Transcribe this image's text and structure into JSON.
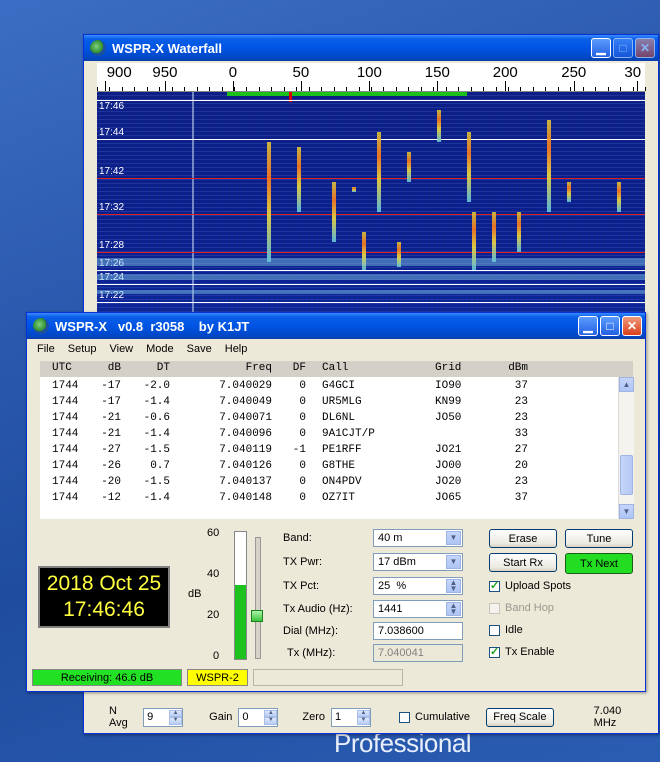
{
  "desktop": {
    "text": "Professional"
  },
  "waterfall": {
    "title": "WSPR-X Waterfall",
    "freq_ticks": [
      {
        "label": "900",
        "pos": 0.015
      },
      {
        "label": "950",
        "pos": 0.124
      },
      {
        "label": "0",
        "pos": 0.248
      },
      {
        "label": "50",
        "pos": 0.372
      },
      {
        "label": "100",
        "pos": 0.497
      },
      {
        "label": "150",
        "pos": 0.621
      },
      {
        "label": "200",
        "pos": 0.745
      },
      {
        "label": "250",
        "pos": 0.87
      },
      {
        "label": "30",
        "pos": 0.985
      }
    ],
    "time_labels": [
      "17:46",
      "17:44",
      "17:42",
      "17:32",
      "17:28",
      "17:26",
      "17:24",
      "17:22"
    ],
    "controls": {
      "navg_label": "N Avg",
      "navg_value": "9",
      "gain_label": "Gain",
      "gain_value": "0",
      "zero_label": "Zero",
      "zero_value": "1",
      "cumulative_label": "Cumulative",
      "freq_scale_label": "Freq Scale",
      "freq_readout": "7.040 MHz"
    },
    "colors": {
      "range_bar": "#19c119",
      "marker": "#e00000"
    }
  },
  "main": {
    "title": "WSPR-X   v0.8  r3058    by K1JT",
    "menu": [
      "File",
      "Setup",
      "View",
      "Mode",
      "Save",
      "Help"
    ],
    "columns": [
      "UTC",
      "dB",
      "DT",
      "Freq",
      "DF",
      "Call",
      "Grid",
      "dBm"
    ],
    "rows": [
      {
        "utc": "1744",
        "db": "-17",
        "dt": "-2.0",
        "freq": "7.040029",
        "df": "0",
        "call": "G4GCI",
        "grid": "IO90",
        "dbm": "37"
      },
      {
        "utc": "1744",
        "db": "-17",
        "dt": "-1.4",
        "freq": "7.040049",
        "df": "0",
        "call": "UR5MLG",
        "grid": "KN99",
        "dbm": "23"
      },
      {
        "utc": "1744",
        "db": "-21",
        "dt": "-0.6",
        "freq": "7.040071",
        "df": "0",
        "call": "DL6NL",
        "grid": "JO50",
        "dbm": "23"
      },
      {
        "utc": "1744",
        "db": "-21",
        "dt": "-1.4",
        "freq": "7.040096",
        "df": "0",
        "call": "9A1CJT/P",
        "grid": "",
        "dbm": "33"
      },
      {
        "utc": "1744",
        "db": "-27",
        "dt": "-1.5",
        "freq": "7.040119",
        "df": "-1",
        "call": "PE1RFF",
        "grid": "JO21",
        "dbm": "27"
      },
      {
        "utc": "1744",
        "db": "-26",
        "dt": "0.7",
        "freq": "7.040126",
        "df": "0",
        "call": "G8THE",
        "grid": "JO00",
        "dbm": "20"
      },
      {
        "utc": "1744",
        "db": "-20",
        "dt": "-1.5",
        "freq": "7.040137",
        "df": "0",
        "call": "ON4PDV",
        "grid": "JO20",
        "dbm": "23"
      },
      {
        "utc": "1744",
        "db": "-12",
        "dt": "-1.4",
        "freq": "7.040148",
        "df": "0",
        "call": "OZ7IT",
        "grid": "JO65",
        "dbm": "37"
      }
    ],
    "clock": {
      "date": "2018 Oct 25",
      "time": "17:46:46"
    },
    "meter": {
      "ticks": [
        "60",
        "40",
        "20",
        "0"
      ],
      "unit": "dB",
      "level_db": 35
    },
    "settings": {
      "band_label": "Band:",
      "band_value": "40 m",
      "txpwr_label": "TX Pwr:",
      "txpwr_value": "17 dBm",
      "txpct_label": "TX Pct:",
      "txpct_value": "25  %",
      "txaudio_label": "Tx Audio (Hz):",
      "txaudio_value": "1441",
      "dial_label": "Dial (MHz):",
      "dial_value": "7.038600",
      "tx_label": "Tx (MHz):",
      "tx_value": "7.040041"
    },
    "buttons": {
      "erase": "Erase",
      "tune": "Tune",
      "start_rx": "Start Rx",
      "tx_next": "Tx Next"
    },
    "checks": {
      "upload_spots": "Upload Spots",
      "band_hop": "Band Hop",
      "idle": "Idle",
      "tx_enable": "Tx Enable"
    },
    "status": {
      "receiving": "Receiving:  46.6 dB",
      "mode": "WSPR-2"
    },
    "colors": {
      "receiving_bg": "#22e022",
      "mode_bg": "#ffff00",
      "tx_next_bg": "#22dd22"
    }
  }
}
